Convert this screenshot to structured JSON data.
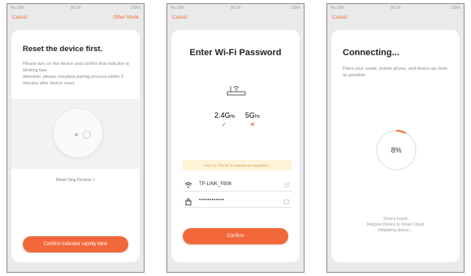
{
  "screens": [
    {
      "status": {
        "left": "No SIM",
        "time": "09:34",
        "right": "100%"
      },
      "nav": {
        "left": "Cancel",
        "right": "Other Mode"
      },
      "title": "Reset the device first.",
      "description": "Please turn on the device and confirm that indicator is blinking fast.\nAttention: please complete pairing process within 3 minutes after device reset.",
      "link": "Reset Sing Devices >",
      "button": "Confirm indicator rapidly blink"
    },
    {
      "status": {
        "left": "No SIM",
        "time": "09:34",
        "right": "100%"
      },
      "nav": {
        "left": "Cancel"
      },
      "title": "Enter Wi-Fi Password",
      "bands": [
        {
          "label": "2.4G",
          "unit": "Hz",
          "mark": "✓",
          "color": "#2fb36b"
        },
        {
          "label": "5G",
          "unit": "Hz",
          "mark": "✕",
          "color": "#e24a3b"
        }
      ],
      "warning": "Only 2.4 GHz Wi-Fi networks are supported >",
      "wifi_ssid": "TP-LINK_F806",
      "wifi_password": "••••••••••••",
      "button": "Confirm"
    },
    {
      "status": {
        "left": "No SIM",
        "time": "09:34",
        "right": "100%"
      },
      "nav": {
        "left": "Cancel"
      },
      "title": "Connecting...",
      "description": "Place your router, mobile phone, and device as close as possible",
      "progress_value": 8,
      "progress_text": "8%",
      "status_lines": [
        "Device found",
        "Register Device to Smart Cloud",
        "Initializing device..."
      ]
    }
  ],
  "colors": {
    "accent": "#f2683a",
    "progress_track": "#e6e6e6",
    "progress_fill": "#f06a32"
  }
}
